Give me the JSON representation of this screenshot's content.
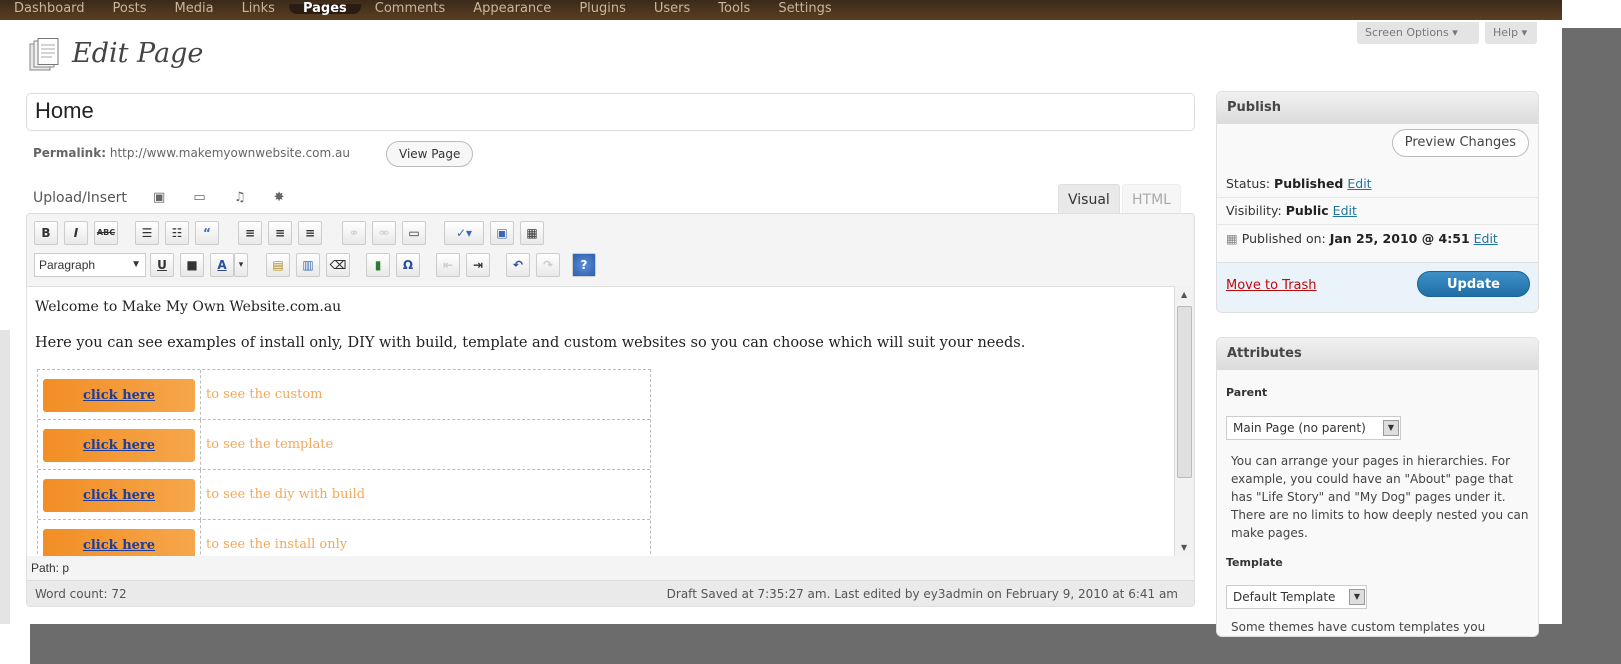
{
  "admin_menu": [
    "Dashboard",
    "Posts",
    "Media",
    "Links",
    "Pages",
    "Comments",
    "Appearance",
    "Plugins",
    "Users",
    "Tools",
    "Settings"
  ],
  "active_menu_index": 4,
  "header": {
    "screen_options": "Screen Options ▾",
    "help": "Help ▾",
    "title": "Edit Page"
  },
  "post": {
    "title": "Home",
    "permalink_label": "Permalink:",
    "permalink_url": "http://www.makemyownwebsite.com.au",
    "view_page": "View Page"
  },
  "editor": {
    "upload_insert": "Upload/Insert",
    "upload_icons": "▣ ▭ ♫ ✸",
    "tab_visual": "Visual",
    "tab_html": "HTML",
    "toolbar1": [
      "B",
      "I",
      "ABC",
      "☰",
      "☷",
      "“",
      "≡",
      "≡",
      "≡",
      "⚭",
      "⚮",
      "▭",
      "✓▾",
      "▣",
      "▦"
    ],
    "format_select": "Paragraph",
    "toolbar2": [
      "U",
      "■",
      "A",
      "▾",
      "▤",
      "▥",
      "⌫",
      "▮",
      "Ω",
      "⇤",
      "⇥",
      "↶",
      "↷",
      "?"
    ],
    "welcome": "Welcome to Make My Own Website.com.au",
    "intro": "Here you can see examples of install only, DIY with build, template and custom websites so you can choose which will suit your needs.",
    "rows": [
      {
        "button": "click here",
        "text": "to see the custom"
      },
      {
        "button": "click here",
        "text": "to see the template"
      },
      {
        "button": "click here",
        "text": "to see the diy with build"
      },
      {
        "button": "click here",
        "text": "to see the install only"
      }
    ],
    "path": "Path: p",
    "word_count": "Word count: 72",
    "draft_saved": "Draft Saved at 7:35:27 am. Last edited by ey3admin on February 9, 2010 at 6:41 am"
  },
  "publish": {
    "heading": "Publish",
    "preview_changes": "Preview Changes",
    "status_label": "Status:",
    "status_value": "Published",
    "visibility_label": "Visibility:",
    "visibility_value": "Public",
    "published_on_label": "Published on:",
    "published_on_value": "Jan 25, 2010 @ 4:51",
    "edit_link": "Edit",
    "move_to_trash": "Move to Trash",
    "update": "Update"
  },
  "attributes": {
    "heading": "Attributes",
    "parent_label": "Parent",
    "parent_value": "Main Page (no parent)",
    "parent_help": "You can arrange your pages in hierarchies. For example, you could have an \"About\" page that has \"Life Story\" and \"My Dog\" pages under it. There are no limits to how deeply nested you can make pages.",
    "template_label": "Template",
    "template_value": "Default Template",
    "template_help_partial": "Some themes have custom templates you"
  }
}
